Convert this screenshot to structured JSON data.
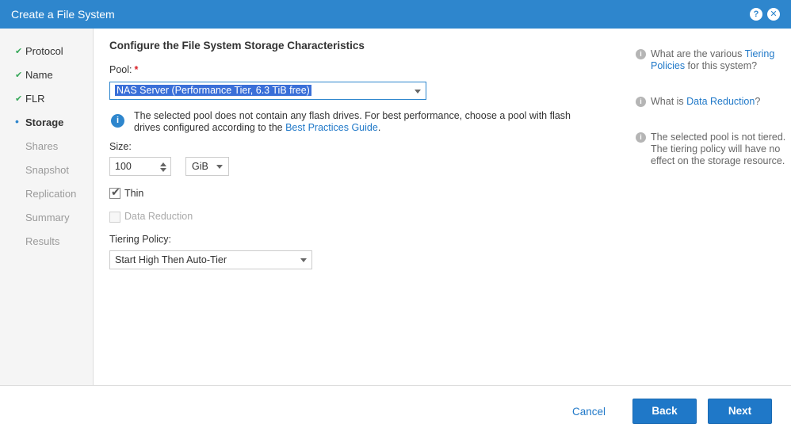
{
  "dialog": {
    "title": "Create a File System",
    "help_glyph": "?",
    "close_glyph": "✕"
  },
  "sidebar": {
    "steps": [
      {
        "label": "Protocol",
        "state": "done",
        "mark": "✔"
      },
      {
        "label": "Name",
        "state": "done",
        "mark": "✔"
      },
      {
        "label": "FLR",
        "state": "done",
        "mark": "✔"
      },
      {
        "label": "Storage",
        "state": "current",
        "mark": "•"
      },
      {
        "label": "Shares",
        "state": "pending",
        "mark": ""
      },
      {
        "label": "Snapshot",
        "state": "pending",
        "mark": ""
      },
      {
        "label": "Replication",
        "state": "pending",
        "mark": ""
      },
      {
        "label": "Summary",
        "state": "pending",
        "mark": ""
      },
      {
        "label": "Results",
        "state": "pending",
        "mark": ""
      }
    ]
  },
  "main": {
    "section_title": "Configure the File System Storage Characteristics",
    "pool": {
      "label": "Pool:",
      "required_mark": "*",
      "selected": "NAS Server (Performance Tier, 6.3 TiB free)"
    },
    "note": {
      "info_glyph": "i",
      "text_before": "The selected pool does not contain any flash drives. For best performance, choose a pool with flash drives configured according to the ",
      "link": "Best Practices Guide",
      "text_after": "."
    },
    "size": {
      "label": "Size:",
      "value": "100",
      "unit": "GiB"
    },
    "thin": {
      "label": "Thin",
      "checked": true,
      "tick": "✔"
    },
    "data_reduction": {
      "label": "Data Reduction",
      "checked": false,
      "disabled": true
    },
    "tiering": {
      "label": "Tiering Policy:",
      "selected": "Start High Then Auto-Tier"
    }
  },
  "help": {
    "icon_glyph": "i",
    "q1_before": "What are the various ",
    "q1_link": "Tiering Policies",
    "q1_after": " for this system?",
    "q2_before": "What is ",
    "q2_link": "Data Reduction",
    "q2_after": "?",
    "note": "The selected pool is not tiered. The tiering policy will have no effect on the storage resource."
  },
  "footer": {
    "cancel_label": "Cancel",
    "back_label": "Back",
    "next_label": "Next"
  },
  "colors": {
    "accent": "#2e86cd",
    "button": "#1f78c8",
    "done_check": "#38a85a",
    "required": "#d9232a"
  }
}
